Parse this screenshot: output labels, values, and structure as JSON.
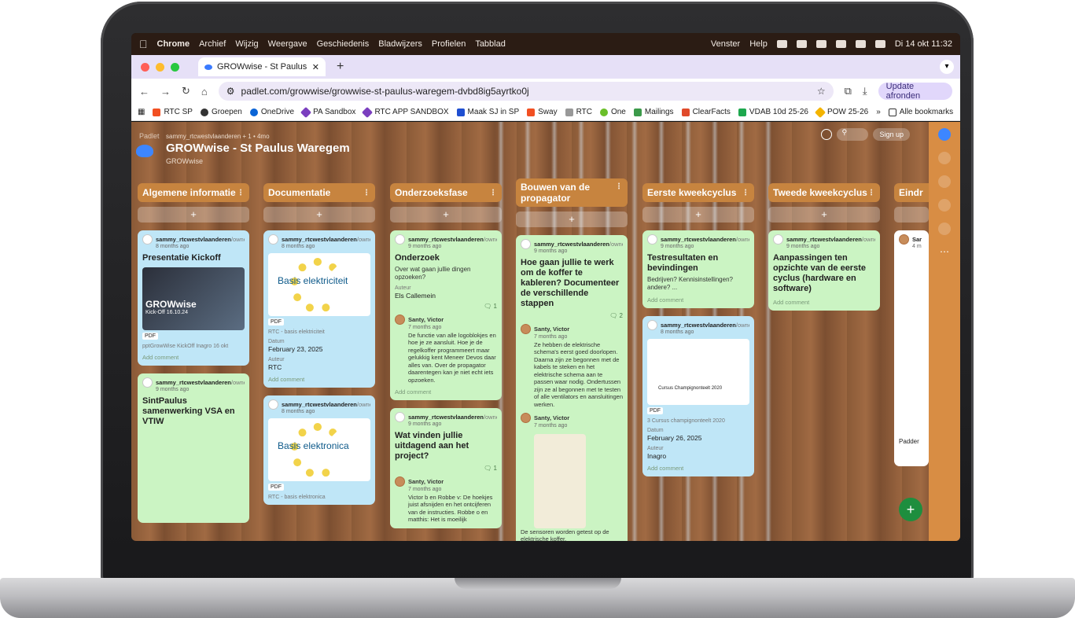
{
  "menubar": {
    "app": "Chrome",
    "items": [
      "Archief",
      "Wijzig",
      "Weergave",
      "Geschiedenis",
      "Bladwijzers",
      "Profielen",
      "Tabblad"
    ],
    "right_items": [
      "Venster",
      "Help"
    ],
    "clock": "Di 14 okt 11:32"
  },
  "browser": {
    "tab_title": "GROWwise - St Paulus Wareg",
    "url": "padlet.com/growwise/growwise-st-paulus-waregem-dvbd8ig5ayrtko0j",
    "update_button": "Update afronden",
    "bookmarks": [
      "RTC SP",
      "Groepen",
      "OneDrive",
      "PA Sandbox",
      "RTC APP SANDBOX",
      "Maak SJ in SP",
      "Sway",
      "RTC",
      "One",
      "Mailings",
      "ClearFacts",
      "VDAB 10d 25-26",
      "POW 25-26"
    ],
    "all_bookmarks": "Alle bookmarks",
    "more": "»"
  },
  "padlet": {
    "brand": "Padlet",
    "author_line": "sammy_rtcwestvlaanderen + 1 • 4mo",
    "title": "GROWwise - St Paulus Waregem",
    "subtitle": "GROWwise",
    "signup": "Sign up",
    "add_symbol": "+",
    "fab": "+",
    "add_comment": "Add comment",
    "columns": [
      {
        "title": "Algemene informatie",
        "cards": [
          {
            "user": "sammy_rtcwestvlaanderen",
            "role": "/owne",
            "ago": "8 months ago",
            "title": "Presentatie Kickoff",
            "thumb_text": "GROWwise",
            "thumb_sub": "Kick-Off 16.10.24",
            "pdf": "PDF",
            "file": "pptGrowWise KickOff Inagro 16 okt"
          },
          {
            "user": "sammy_rtcwestvlaanderen",
            "role": "/owne",
            "ago": "9 months ago",
            "title": "SintPaulus samenwerking VSA en VTIW"
          }
        ]
      },
      {
        "title": "Documentatie",
        "cards": [
          {
            "user": "sammy_rtcwestvlaanderen",
            "role": "/owne",
            "ago": "8 months ago",
            "thumb_text": "Basis elektriciteit",
            "pdf": "PDF",
            "file": "RTC - basis elektriciteit",
            "date_label": "Datum",
            "date": "February 23, 2025",
            "author_label": "Auteur",
            "author": "RTC"
          },
          {
            "user": "sammy_rtcwestvlaanderen",
            "role": "/owne",
            "ago": "8 months ago",
            "thumb_text": "Basis elektronica",
            "pdf": "PDF",
            "file": "RTC - basis elektronica"
          }
        ]
      },
      {
        "title": "Onderzoeksfase",
        "cards": [
          {
            "user": "sammy_rtcwestvlaanderen",
            "role": "/owne",
            "ago": "9 months ago",
            "title": "Onderzoek",
            "body": "Over wat gaan jullie dingen opzoeken?",
            "author_label": "Auteur",
            "author": "Els Callemein",
            "count": "1",
            "comment_user": "Santy, Victor",
            "comment_ago": "7 months ago",
            "comment": "De functie van alle logoblokjes en hoe je ze aansluit. Hoe je de regelkoffer programmeert maar gelukkig kent Meneer Devos daar alles van. Over de propagator daarentegen kan je niet echt iets opzoeken."
          },
          {
            "user": "sammy_rtcwestvlaanderen",
            "role": "/owne",
            "ago": "9 months ago",
            "title": "Wat vinden jullie uitdagend aan het project?",
            "count": "1",
            "comment_user": "Santy, Victor",
            "comment_ago": "7 months ago",
            "comment": "Victor b en Robbe v: De hoekjes juist afsnijden en het ontcijferen van de instructies. Robbe o en matthis: Het is moeilijk"
          }
        ]
      },
      {
        "title": "Bouwen van de propagator",
        "cards": [
          {
            "user": "sammy_rtcwestvlaanderen",
            "role": "/owne",
            "ago": "9 months ago",
            "title": "Hoe gaan jullie te werk om de koffer te kableren? Documenteer de verschillende stappen",
            "count": "2",
            "comment_user": "Santy, Victor",
            "comment_ago": "7 months ago",
            "comment": "Ze hebben de elektrische schema's eerst goed doorlopen. Daarna zijn ze begonnen met de kabels te steken en het elektrische schema aan te passen waar nodig. Ondertussen zijn ze al begonnen met te testen of alle ventilators en aansluitingen werken.",
            "comment2_user": "Santy, Victor",
            "comment2_ago": "7 months ago",
            "comment2": "De sensoren worden getest op de elektrische koffer."
          }
        ]
      },
      {
        "title": "Eerste kweekcyclus",
        "cards": [
          {
            "user": "sammy_rtcwestvlaanderen",
            "role": "/owne",
            "ago": "9 months ago",
            "title": "Testresultaten en bevindingen",
            "body": "Bedrijven? Kennisinstellingen? andere? ..."
          },
          {
            "user": "sammy_rtcwestvlaanderen",
            "role": "/owne",
            "ago": "8 months ago",
            "thumb_text": "Cursus Champignonteelt 2020",
            "pdf": "PDF",
            "file": "3 Cursus champignonteelt 2020",
            "date_label": "Datum",
            "date": "February 26, 2025",
            "author_label": "Auteur",
            "author": "Inagro"
          }
        ]
      },
      {
        "title": "Tweede kweekcyclus",
        "cards": [
          {
            "user": "sammy_rtcwestvlaanderen",
            "role": "/owne",
            "ago": "9 months ago",
            "title": "Aanpassingen ten opzichte van de eerste cyclus (hardware en software)"
          }
        ]
      },
      {
        "title": "Eindr",
        "cards": [
          {
            "user": "Sar",
            "ago": "4 m",
            "file": "Padder"
          }
        ]
      }
    ]
  }
}
